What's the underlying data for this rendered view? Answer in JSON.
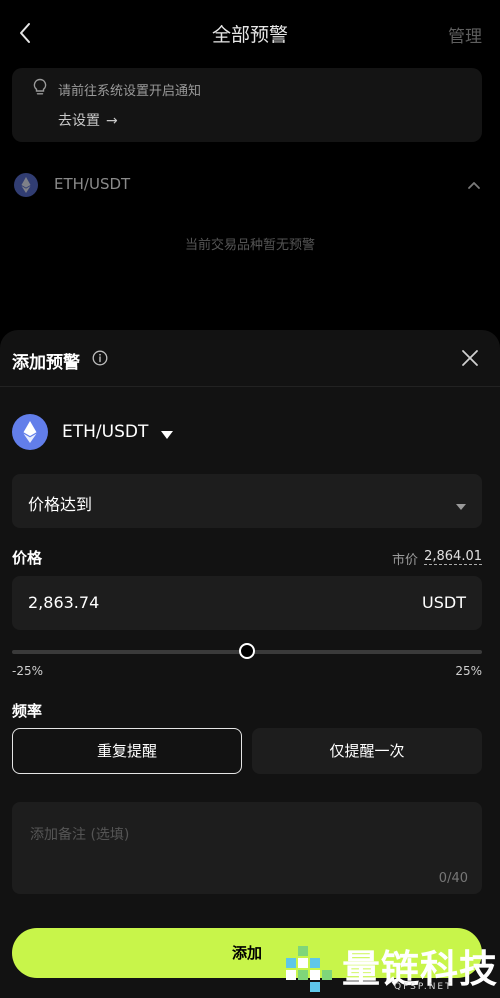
{
  "header": {
    "title": "全部预警",
    "manage_label": "管理"
  },
  "notice": {
    "text": "请前往系统设置开启通知",
    "action_label": "去设置",
    "action_arrow": "→"
  },
  "pair_list": {
    "pair": "ETH/USDT",
    "empty_text": "当前交易品种暂无预警"
  },
  "sheet": {
    "title": "添加预警",
    "pair": "ETH/USDT",
    "condition": "价格达到",
    "price_label": "价格",
    "market_label": "市价",
    "market_value": "2,864.01",
    "price_value": "2,863.74",
    "price_unit": "USDT",
    "slider": {
      "min_label": "-25%",
      "max_label": "25%",
      "value_fraction": 0.5
    },
    "frequency_label": "频率",
    "frequency_options": [
      "重复提醒",
      "仅提醒一次"
    ],
    "frequency_selected": 0,
    "note_placeholder": "添加备注 (选填)",
    "note_count": "0/40",
    "add_label": "添加"
  },
  "watermark": {
    "text": "量链科技",
    "sub": "QFSP.NET"
  },
  "colors": {
    "accent": "#c8f54a",
    "eth": "#627eea",
    "background": "#000000",
    "sheet": "#121212",
    "field": "#1d1d1d"
  }
}
